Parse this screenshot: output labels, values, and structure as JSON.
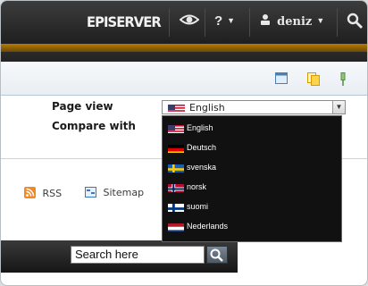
{
  "topbar": {
    "brand": "EPISERVER",
    "help_label": "?",
    "user_label": "deniz"
  },
  "compare": {
    "page_view_label": "Page view",
    "compare_with_label": "Compare with",
    "selected_language": "English"
  },
  "languages": [
    {
      "label": "English",
      "flag": "us-flag-icon"
    },
    {
      "label": "Deutsch",
      "flag": "de-flag-icon"
    },
    {
      "label": "svenska",
      "flag": "se-flag-icon"
    },
    {
      "label": "norsk",
      "flag": "no-flag-icon"
    },
    {
      "label": "suomi",
      "flag": "fi-flag-icon"
    },
    {
      "label": "Nederlands",
      "flag": "nl-flag-icon"
    }
  ],
  "links": {
    "rss": "RSS",
    "sitemap": "Sitemap"
  },
  "search": {
    "value": "Search here"
  },
  "colors": {
    "accent": "#c8890a",
    "dropdown_bg": "#111111",
    "topbar_bg": "#262626"
  }
}
